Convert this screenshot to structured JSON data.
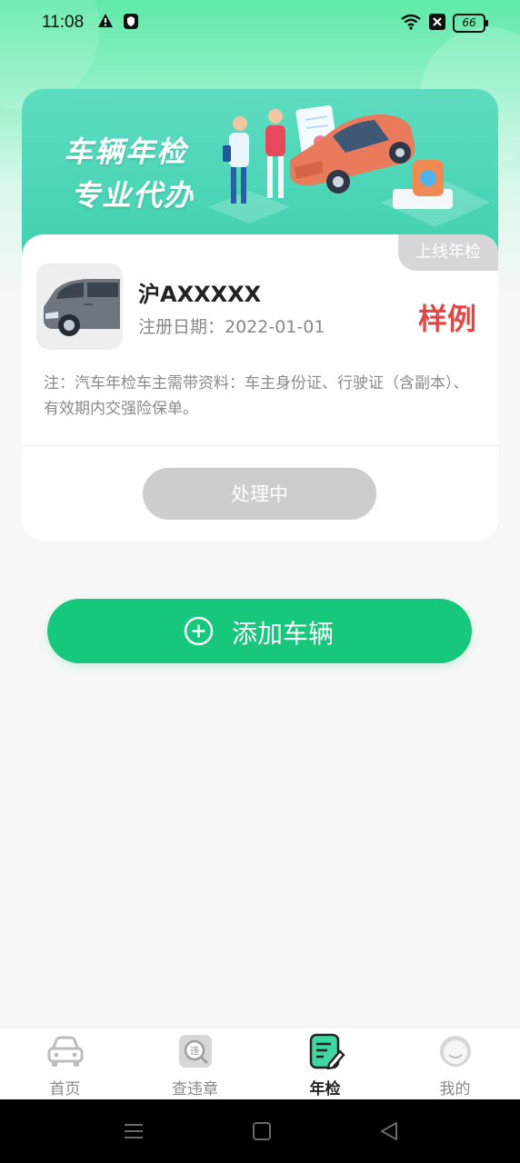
{
  "status_bar": {
    "time": "11:08",
    "icons": [
      "warning-icon",
      "security-shield-icon",
      "wifi-icon",
      "sim-x-icon",
      "battery-icon"
    ],
    "battery": "66"
  },
  "banner": {
    "line1": "车辆年检",
    "line2": "专业代办"
  },
  "vehicle_card": {
    "tag": "上线年检",
    "plate": "沪AXXXXX",
    "reg_date": "注册日期：2022-01-01",
    "sample_label": "样例",
    "note": "注：汽车年检车主需带资料：车主身份证、行驶证（含副本）、有效期内交强险保单。",
    "status_button": "处理中"
  },
  "add_vehicle_button": "添加车辆",
  "bottom_nav": {
    "active": "年检",
    "items": [
      {
        "label": "首页",
        "icon": "car-icon"
      },
      {
        "label": "查违章",
        "icon": "violation-search-icon"
      },
      {
        "label": "年检",
        "icon": "inspection-edit-icon"
      },
      {
        "label": "我的",
        "icon": "profile-smile-icon"
      }
    ]
  },
  "colors": {
    "accent": "#17c77c",
    "banner": "#3fd1b0",
    "sample_red": "#e04848"
  }
}
